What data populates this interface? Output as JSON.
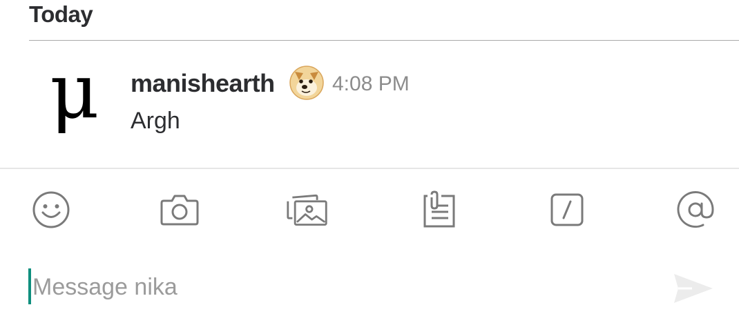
{
  "day_divider": {
    "label": "Today"
  },
  "message": {
    "avatar_glyph": "μ",
    "author": "manishearth",
    "status_emoji": "doge-emoji",
    "time": "4:08 PM",
    "text": "Argh"
  },
  "toolbar": {
    "icons": [
      "smiley-icon",
      "camera-icon",
      "photos-icon",
      "file-icon",
      "slash-command-icon",
      "at-mention-icon"
    ],
    "icon_color": "#7a7a7a"
  },
  "composer": {
    "placeholder": "Message nika",
    "value": "",
    "caret_color": "#0f8f7e",
    "send_icon": "send-icon"
  }
}
